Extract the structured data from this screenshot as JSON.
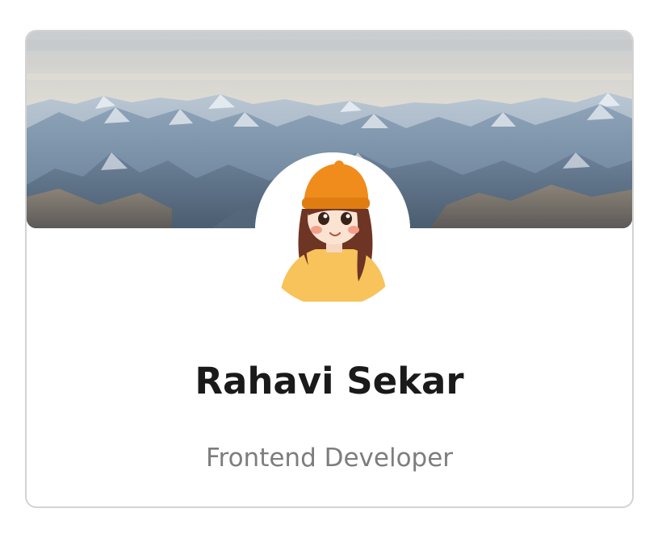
{
  "profile": {
    "name": "Rahavi Sekar",
    "role": "Frontend Developer"
  },
  "images": {
    "banner": "mountain-landscape",
    "avatar": "girl-with-orange-beanie-illustration"
  },
  "colors": {
    "card_border": "#d3d3d3",
    "name_text": "#1a1a1a",
    "role_text": "#7d7d7d",
    "beanie": "#f08c1c",
    "sweater": "#f7c35a",
    "hair": "#6e3524"
  }
}
